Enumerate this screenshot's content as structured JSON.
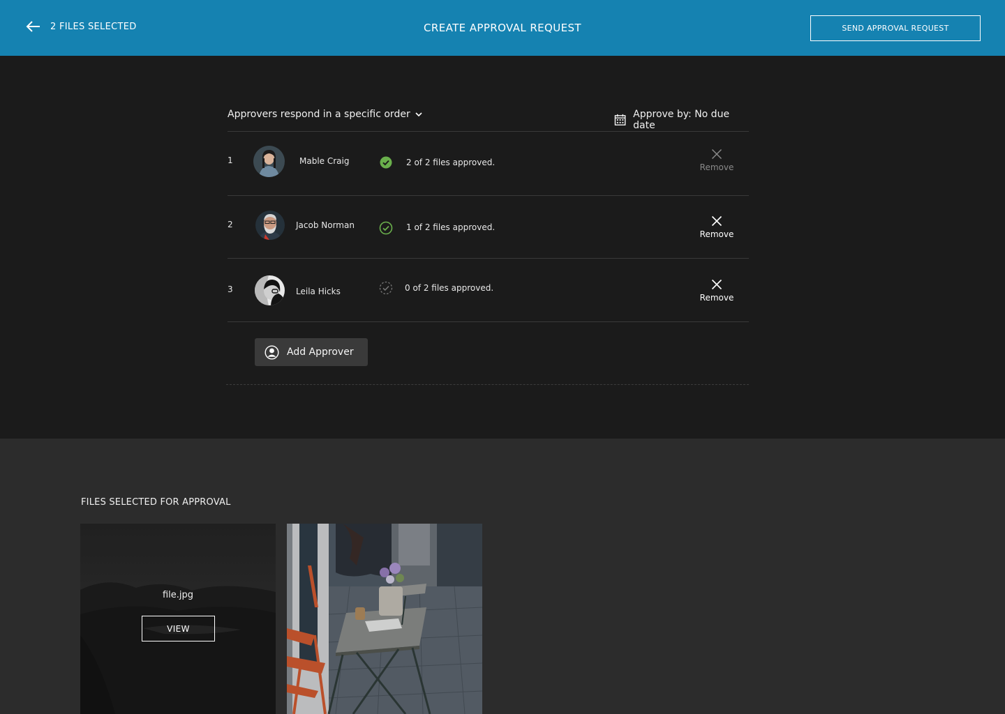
{
  "header": {
    "back_label": "2 FILES SELECTED",
    "title": "CREATE APPROVAL REQUEST",
    "send_label": "SEND APPROVAL REQUEST"
  },
  "approval": {
    "order_label": "Approvers respond in a specific order",
    "due_label": "Approve by: No due date",
    "approvers": [
      {
        "number": "1",
        "name": "Mable Craig",
        "status": "2 of 2 files approved.",
        "status_kind": "approved",
        "remove_label": "Remove"
      },
      {
        "number": "2",
        "name": "Jacob Norman",
        "status": "1 of 2 files approved.",
        "status_kind": "partial",
        "remove_label": "Remove"
      },
      {
        "number": "3",
        "name": "Leila Hicks",
        "status": "0 of 2 files approved.",
        "status_kind": "pending",
        "remove_label": "Remove"
      }
    ],
    "add_label": "Add Approver"
  },
  "files": {
    "heading": "FILES SELECTED FOR APPROVAL",
    "items": [
      {
        "name": "file.jpg",
        "view_label": "VIEW"
      }
    ]
  },
  "colors": {
    "header_bg": "#1582b1",
    "approved_green": "#6ab04c",
    "panel_dark": "#1b1b1b",
    "panel_lower": "#2c2c2c"
  }
}
